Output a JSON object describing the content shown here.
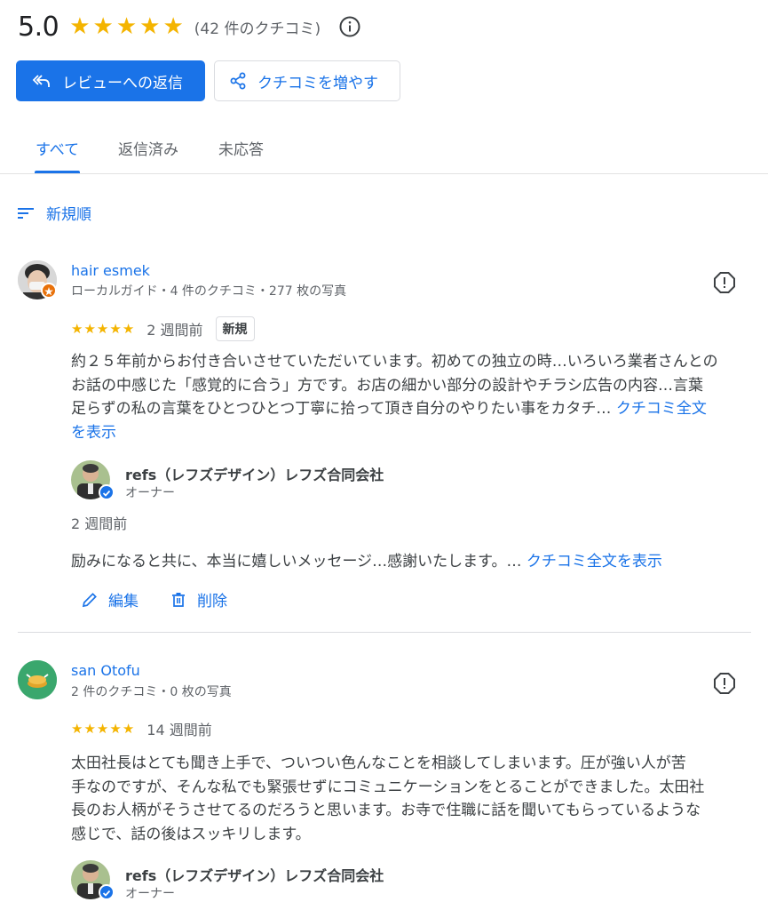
{
  "summary": {
    "rating": "5.0",
    "count": "(42 件のクチコミ)",
    "star_color": "#f4b400"
  },
  "buttons": {
    "reply": "レビューへの返信",
    "share": "クチコミを増やす"
  },
  "tabs": [
    {
      "label": "すべて",
      "active": true
    },
    {
      "label": "返信済み",
      "active": false
    },
    {
      "label": "未応答",
      "active": false
    }
  ],
  "sort": {
    "label": "新規順"
  },
  "reviews": [
    {
      "author": "hair esmek",
      "meta": "ローカルガイド・4 件のクチコミ・277 枚の写真",
      "stars": 5,
      "time": "2 週間前",
      "badge": "新規",
      "text_lines": [
        "約２５年前からお付き合いさせていただいています。初めての独立の時…いろいろ業者さんとの",
        "お話の中感じた「感覚的に合う」方です。お店の細かい部分の設計やチラシ広告の内容…言葉",
        "足らずの私の言葉をひとつひとつ丁寧に拾って頂き自分のやりたい事をカタチ…"
      ],
      "more_link_a": "クチコミ全文",
      "more_link_b": "を表示",
      "reply": {
        "owner": "refs（レフズデザイン）レフズ合同会社",
        "role": "オーナー",
        "time": "2 週間前",
        "text": "励みになると共に、本当に嬉しいメッセージ…感謝いたします。…",
        "more_link": "クチコミ全文を表示",
        "edit": "編集",
        "delete": "削除"
      }
    },
    {
      "author": "san Otofu",
      "meta": "2 件のクチコミ・0 枚の写真",
      "stars": 5,
      "time": "14 週間前",
      "text_lines": [
        "太田社長はとても聞き上手で、ついつい色んなことを相談してしまいます。圧が強い人が苦",
        "手なのですが、そんな私でも緊張せずにコミュニケーションをとることができました。太田社",
        "長のお人柄がそうさせてるのだろうと思います。お寺で住職に話を聞いてもらっているような",
        "感じで、話の後はスッキリします。"
      ],
      "reply": {
        "owner": "refs（レフズデザイン）レフズ合同会社",
        "role": "オーナー"
      }
    }
  ]
}
